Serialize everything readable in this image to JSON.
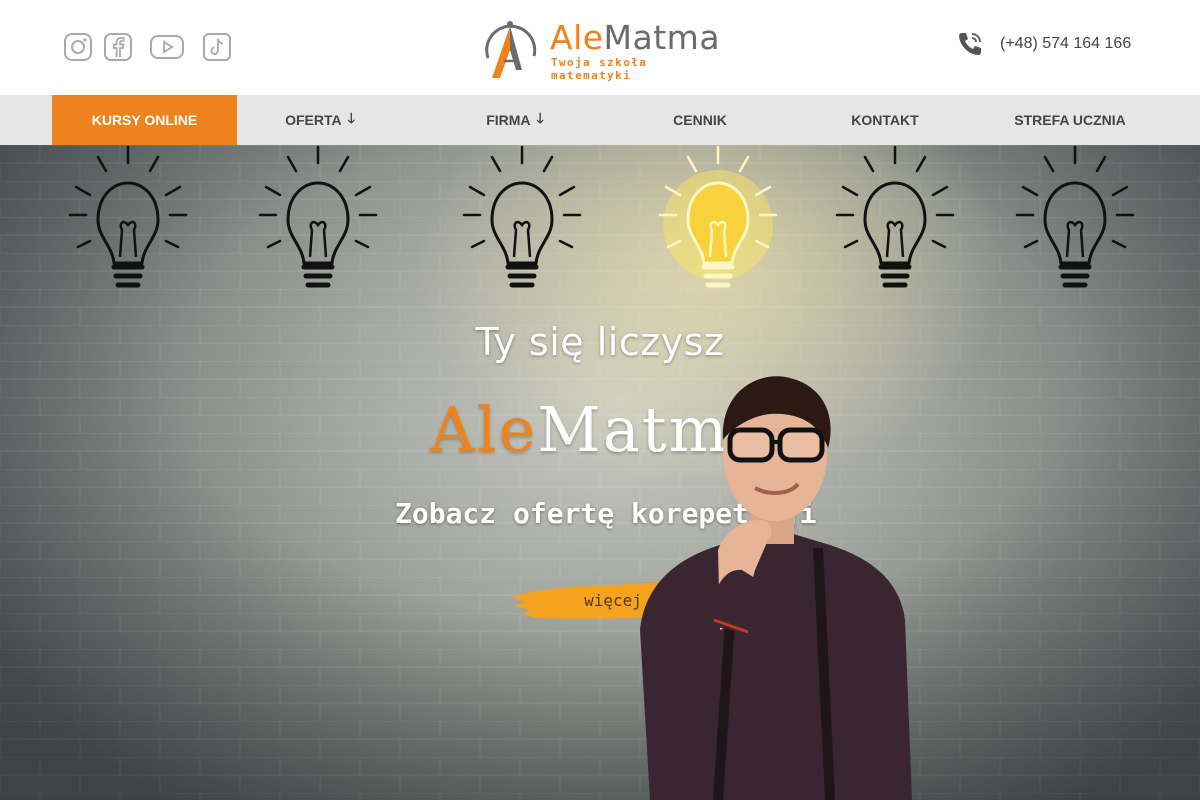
{
  "header": {
    "socials": [
      {
        "name": "instagram-icon"
      },
      {
        "name": "facebook-icon"
      },
      {
        "name": "youtube-icon"
      },
      {
        "name": "tiktok-icon"
      }
    ],
    "logo": {
      "ale": "Ale",
      "matma": "Matma",
      "tagline": "Twoja szkoła matematyki"
    },
    "phone": "(+48) 574 164 166"
  },
  "nav": {
    "items": [
      {
        "label": "KURSY ONLINE",
        "active": true
      },
      {
        "label": "OFERTA",
        "dropdown": true
      },
      {
        "label": "FIRMA",
        "dropdown": true
      },
      {
        "label": "CENNIK"
      },
      {
        "label": "KONTAKT"
      },
      {
        "label": "STREFA UCZNIA"
      }
    ]
  },
  "hero": {
    "headline": "Ty się liczysz",
    "brand_ale": "Ale",
    "brand_matma": "Matma",
    "subheadline": "Zobacz ofertę korepetycji",
    "button": "więcej"
  },
  "colors": {
    "accent": "#f0821e",
    "nav_bg": "#e6e6e6",
    "text_dark": "#444444"
  }
}
